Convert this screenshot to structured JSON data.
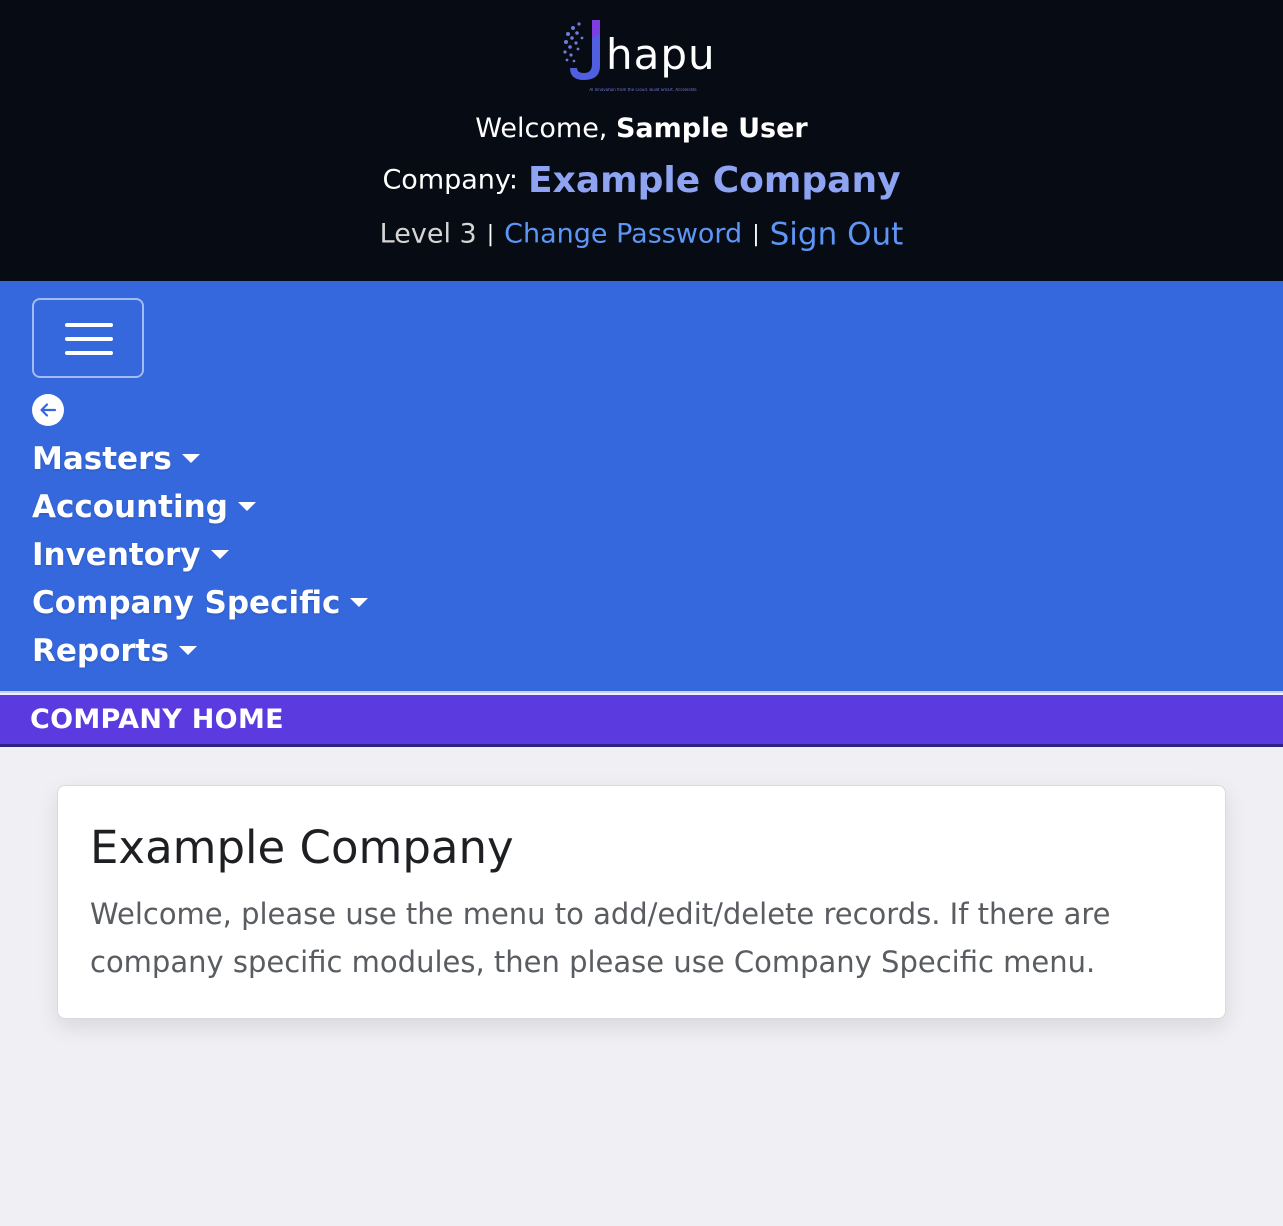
{
  "brand": {
    "name": "hapu",
    "logo_letter": "J",
    "logo_icon": "brain-j-logo-icon",
    "tagline": "AI Innovation from the Cloud. Build Smart. Accelerate",
    "accent_color": "#6d7bd8"
  },
  "header": {
    "welcome_prefix": "Welcome,",
    "user_name": "Sample User",
    "company_label": "Company:",
    "company_name": "Example Company",
    "level": "Level 3",
    "separator": "|",
    "change_password": "Change Password",
    "sign_out": "Sign Out",
    "background_color": "#070b14",
    "link_color": "#5d96f5"
  },
  "navbar": {
    "background_color": "#3568dc",
    "toggler_icon": "hamburger-menu-icon",
    "back_icon": "arrow-left-circle-icon",
    "items": [
      {
        "label": "Masters",
        "icon": "caret-down-icon"
      },
      {
        "label": "Accounting",
        "icon": "caret-down-icon"
      },
      {
        "label": "Inventory",
        "icon": "caret-down-icon"
      },
      {
        "label": "Company Specific",
        "icon": "caret-down-icon"
      },
      {
        "label": "Reports",
        "icon": "caret-down-icon"
      }
    ]
  },
  "section": {
    "title": "COMPANY HOME",
    "background_color": "#5b3ae0"
  },
  "card": {
    "title": "Example Company",
    "text": "Welcome, please use the menu to add/edit/delete records. If there are company specific modules, then please use Company Specific menu."
  }
}
